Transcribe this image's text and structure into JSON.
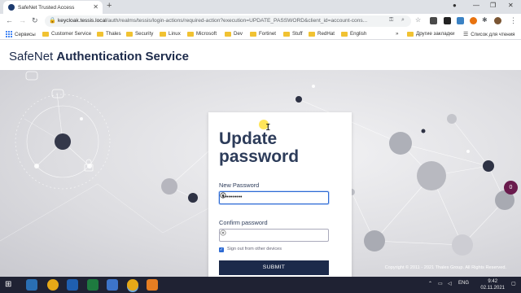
{
  "browser": {
    "tab_title": "SafeNet Trusted Access",
    "url_host": "keycloak.tessis.local",
    "url_rest": "/auth/realms/tessis/login-actions/required-action?execution=UPDATE_PASSWORD&client_id=account-cons...",
    "new_tab_symbol": "+",
    "close_tab_symbol": "✕"
  },
  "bookmarks": {
    "items": [
      "Сервисы",
      "Customer Service",
      "Thales",
      "Security",
      "Linux",
      "Microsoft",
      "Dev",
      "Fortinet",
      "Stuff",
      "RedHat",
      "English"
    ],
    "overflow": "»",
    "other": "Другие закладки",
    "reading_list": "Список для чтения"
  },
  "header": {
    "brand_light": "SafeNet ",
    "brand_bold": "Authentication Service"
  },
  "form": {
    "title": "Update password",
    "new_password_label": "New Password",
    "new_password_value": "••••••••••",
    "confirm_password_label": "Confirm password",
    "confirm_password_value": "",
    "signout_label": "Sign out from other devices",
    "signout_checked": true,
    "submit_label": "SUBMIT"
  },
  "footer": {
    "copyright": "Copyright © 2011 - 2021 Thales Group. All Rights Reserved."
  },
  "chat_badge": "0",
  "taskbar": {
    "lang": "ENG",
    "time": "9:42",
    "date": "02.11.2021"
  },
  "colors": {
    "brand_navy": "#1c2a4a",
    "accent_blue": "#2d6ad3",
    "chat": "#6a1b4d"
  }
}
